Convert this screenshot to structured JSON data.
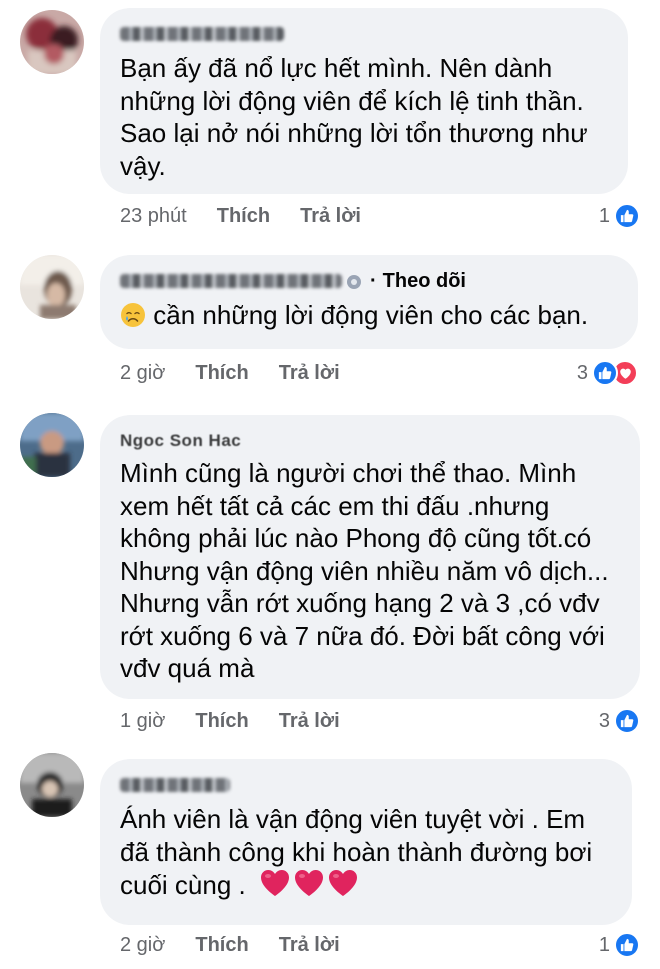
{
  "comments": [
    {
      "author": "Tuyen yen Dinh",
      "text": "Bạn ấy đã nổ lực hết mình. Nên dành những lời động viên để kích lệ tinh thần. Sao lại nở nói những lời tổn thương như vậy.",
      "time": "23 phút",
      "like_label": "Thích",
      "reply_label": "Trả lời",
      "reaction_count": "1",
      "reactions": [
        "like"
      ]
    },
    {
      "author": "Phuong Dang Anh Thu",
      "follow_label": "Theo dõi",
      "emoji": "crying-face",
      "text": "cần những lời động viên cho các bạn.",
      "time": "2 giờ",
      "like_label": "Thích",
      "reply_label": "Trả lời",
      "reaction_count": "3",
      "reactions": [
        "like",
        "love"
      ]
    },
    {
      "author": "Ngoc Son Hac",
      "text": "Mình cũng là người chơi thể thao. Mình xem hết tất cả các em thi đấu .nhưng không phải lúc nào Phong độ cũng tốt.có Nhưng vận động viên nhiều năm vô dịch... Nhưng vẫn rớt xuống hạng 2 và 3  ,có vđv rớt xuống 6 và 7 nữa đó. Đời bất công với vđv quá mà",
      "time": "1 giờ",
      "like_label": "Thích",
      "reply_label": "Trả lời",
      "reaction_count": "3",
      "reactions": [
        "like"
      ]
    },
    {
      "author": "Linh Pham",
      "text": "Ánh viên là vận động viên tuyệt vời . Em đã thành công khi hoàn thành đường bơi cuối cùng .",
      "hearts": [
        "red-heart",
        "red-heart",
        "red-heart"
      ],
      "time": "2 giờ",
      "like_label": "Thích",
      "reply_label": "Trả lời",
      "reaction_count": "1",
      "reactions": [
        "like"
      ]
    }
  ],
  "colors": {
    "bubble": "#f0f2f5",
    "meta_text": "#65676b",
    "like_blue": "#1877f2",
    "love_red": "#f33e58",
    "heart_red": "#e0245e"
  }
}
